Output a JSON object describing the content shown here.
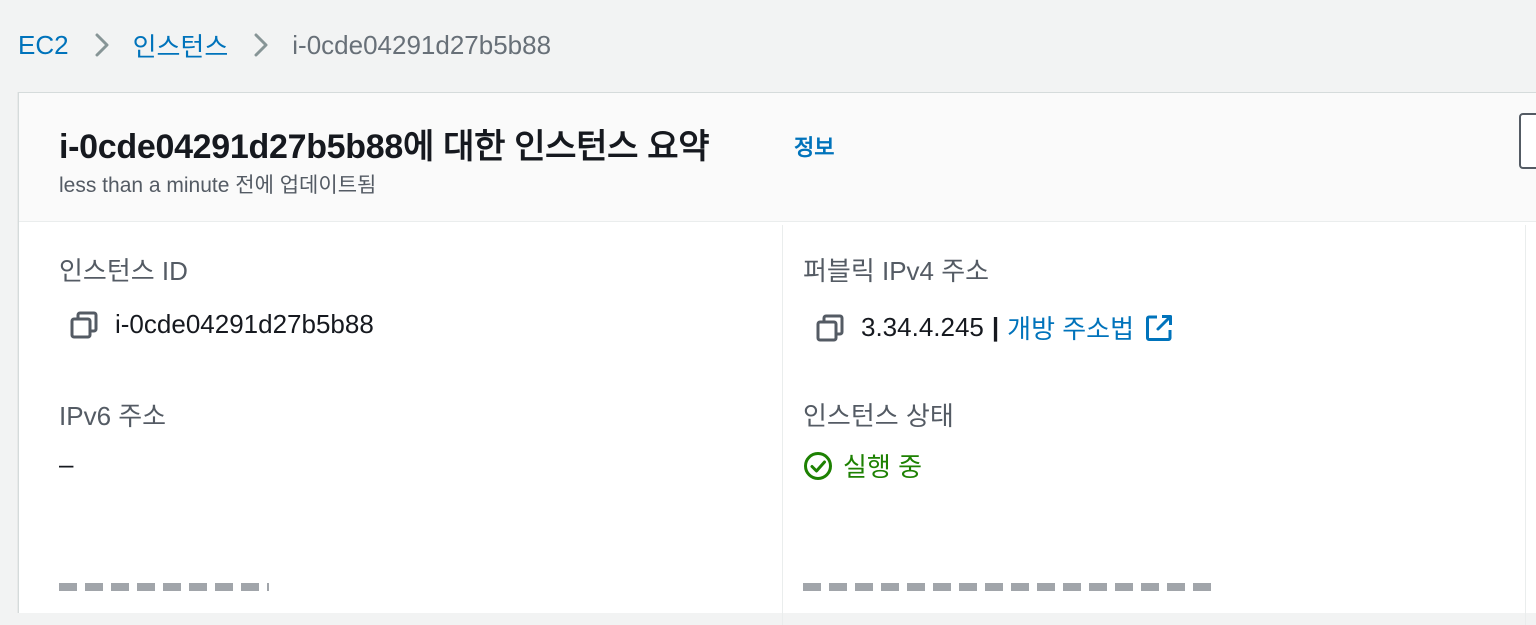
{
  "breadcrumb": {
    "items": [
      "EC2",
      "인스턴스",
      "i-0cde04291d27b5b88"
    ]
  },
  "header": {
    "title": "i-0cde04291d27b5b88에 대한 인스턴스 요약",
    "info_link": "정보",
    "subtitle": "less than a minute 전에 업데이트됨"
  },
  "fields": {
    "instance_id": {
      "label": "인스턴스 ID",
      "value": "i-0cde04291d27b5b88"
    },
    "public_ipv4": {
      "label": "퍼블릭 IPv4 주소",
      "value": "3.34.4.245",
      "separator": "|",
      "link_text": "개방 주소법"
    },
    "ipv6": {
      "label": "IPv6 주소",
      "value": "–"
    },
    "instance_state": {
      "label": "인스턴스 상태",
      "value": "실행 중"
    }
  },
  "colors": {
    "link": "#0073bb",
    "success": "#1d8102",
    "label": "#545b64",
    "text": "#16191f",
    "background": "#f2f3f3"
  },
  "icons": {
    "breadcrumb_separator": "chevron-right-icon",
    "copy": "copy-icon",
    "external": "external-link-icon",
    "status": "check-circle-icon"
  }
}
